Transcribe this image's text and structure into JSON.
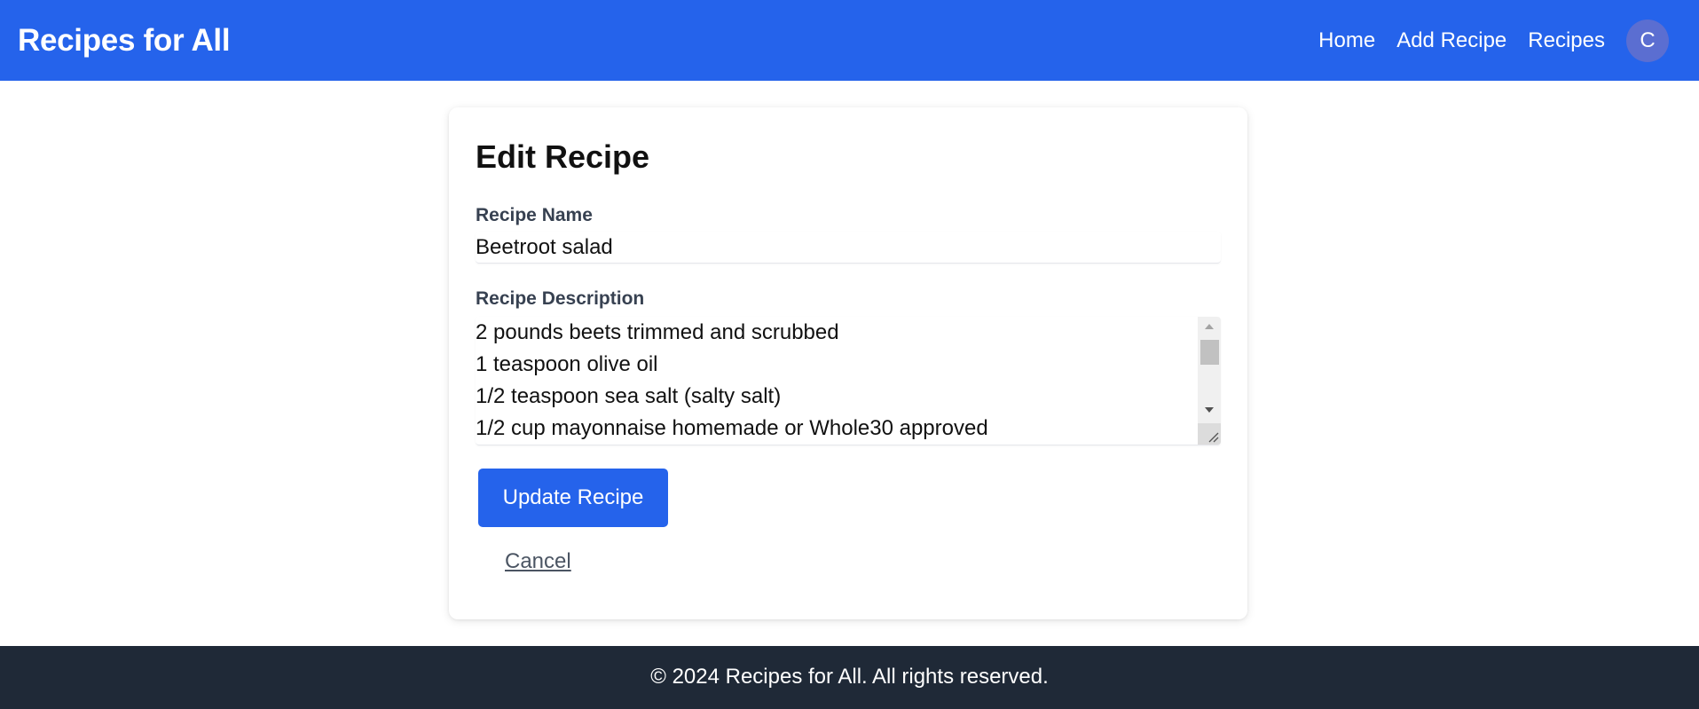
{
  "navbar": {
    "brand": "Recipes for All",
    "links": [
      {
        "label": "Home"
      },
      {
        "label": "Add Recipe"
      },
      {
        "label": "Recipes"
      }
    ],
    "avatar_initial": "C",
    "bg_color": "#2563eb"
  },
  "form": {
    "title": "Edit Recipe",
    "name_label": "Recipe Name",
    "name_value": "Beetroot salad",
    "description_label": "Recipe Description",
    "description_lines": [
      "2 pounds beets trimmed and scrubbed",
      "1 teaspoon olive oil",
      "1/2 teaspoon sea salt (salty salt)",
      "1/2 cup mayonnaise homemade or Whole30 approved"
    ],
    "submit_label": "Update Recipe",
    "cancel_label": "Cancel",
    "accent_color": "#2563eb"
  },
  "footer": {
    "text": "© 2024 Recipes for All. All rights reserved.",
    "bg_color": "#1f2937"
  }
}
